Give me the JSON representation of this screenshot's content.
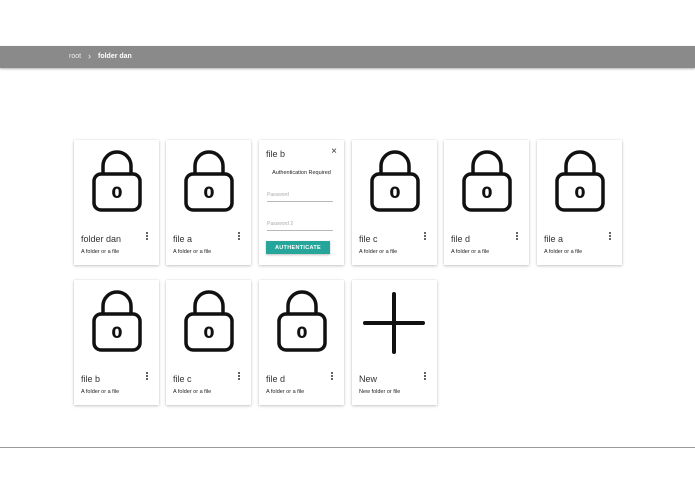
{
  "breadcrumb": {
    "root": "root",
    "separator": "›",
    "current": "folder dan"
  },
  "cards_row1": [
    {
      "title": "folder dan",
      "subtitle": "A folder or a file",
      "icon": "lock-icon"
    },
    {
      "title": "file a",
      "subtitle": "A folder or a file",
      "icon": "lock-icon"
    },
    {
      "title": "file c",
      "subtitle": "A folder or a file",
      "icon": "lock-icon"
    },
    {
      "title": "file d",
      "subtitle": "A folder or a file",
      "icon": "lock-icon"
    },
    {
      "title": "file a",
      "subtitle": "A folder or a file",
      "icon": "lock-icon"
    }
  ],
  "auth_card": {
    "title": "file b",
    "close": "×",
    "message": "Authentication Required",
    "password_placeholder": "Password",
    "password2_placeholder": "Password 2",
    "button_label": "AUTHENTICATE"
  },
  "cards_row2": [
    {
      "title": "file b",
      "subtitle": "A folder or a file",
      "icon": "lock-icon"
    },
    {
      "title": "file c",
      "subtitle": "A folder or a file",
      "icon": "lock-icon"
    },
    {
      "title": "file d",
      "subtitle": "A folder or a file",
      "icon": "lock-icon"
    },
    {
      "title": "New",
      "subtitle": "New folder or file",
      "icon": "plus-icon"
    }
  ],
  "lock_digit": "0",
  "colors": {
    "topbar": "#8a8a8a",
    "accent": "#26a69a"
  }
}
